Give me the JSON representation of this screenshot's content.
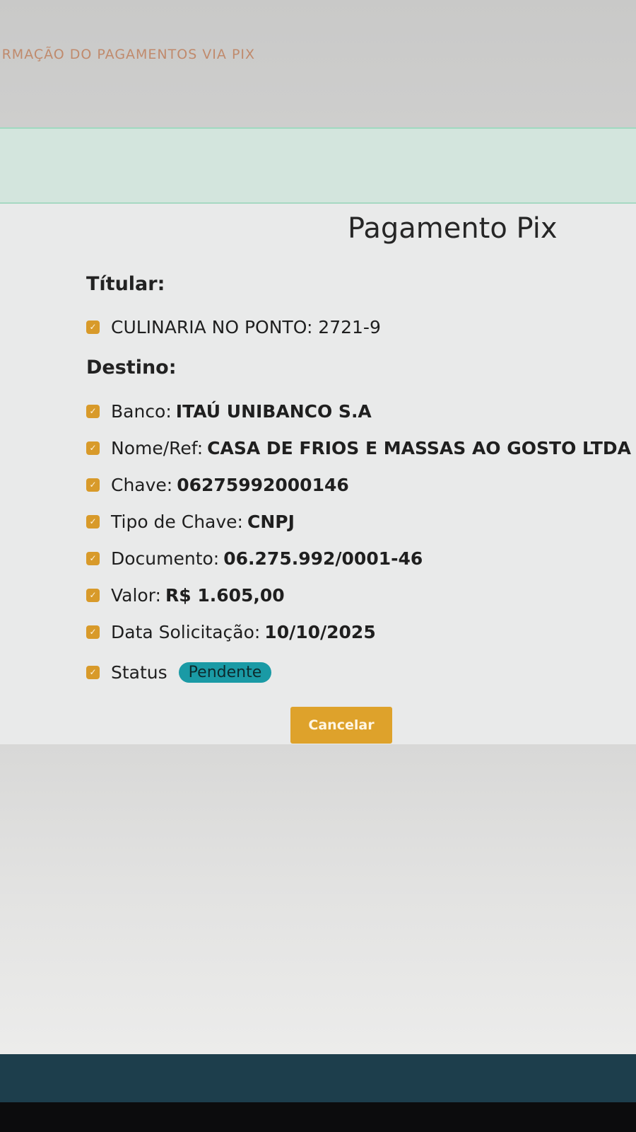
{
  "header": {
    "title": "IRMAÇÃO DO PAGAMENTOS VIA PIX"
  },
  "card": {
    "title": "Pagamento Pix"
  },
  "titular": {
    "label": "Títular:",
    "items": [
      {
        "text": "CULINARIA NO PONTO: 2721-9"
      }
    ]
  },
  "destino": {
    "label": "Destino:",
    "items": [
      {
        "label": "Banco:",
        "value": "ITAÚ UNIBANCO S.A"
      },
      {
        "label": "Nome/Ref:",
        "value": "CASA DE FRIOS E MASSAS AO GOSTO LTDA"
      },
      {
        "label": "Chave:",
        "value": "06275992000146"
      },
      {
        "label": "Tipo de Chave:",
        "value": "CNPJ"
      },
      {
        "label": "Documento:",
        "value": "06.275.992/0001-46"
      },
      {
        "label": "Valor:",
        "value": "R$ 1.605,00"
      },
      {
        "label": "Data Solicitação:",
        "value": "10/10/2025"
      }
    ],
    "status": {
      "label": "Status",
      "badge": "Pendente"
    }
  },
  "actions": {
    "cancel_label": "Cancelar"
  },
  "colors": {
    "accent": "#dea22b",
    "checkbox": "#d89a2a",
    "status_badge": "#1a9aa5",
    "banner": "#d3e5dd",
    "footer": "#1d3e4c"
  },
  "icons": {
    "checkbox": "check-icon"
  }
}
